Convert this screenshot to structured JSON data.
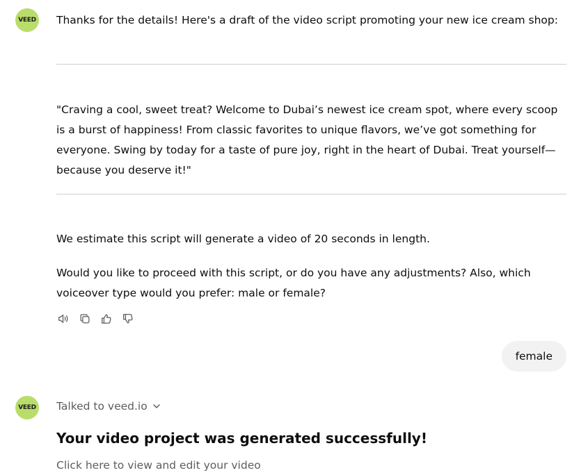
{
  "assistant": {
    "avatar_label": "VEED",
    "intro": "Thanks for the details! Here's a draft of the video script promoting your new ice cream shop:",
    "script_quote": "\"Craving a cool, sweet treat? Welcome to Dubai’s newest ice cream spot, where every scoop is a burst of happiness! From classic favorites to unique flavors, we’ve got something for everyone. Swing by today for a taste of pure joy, right in the heart of Dubai. Treat yourself—because you deserve it!\"",
    "estimate": "We estimate this script will generate a video of 20 seconds in length.",
    "question": "Would you like to proceed with this script, or do you have any adjustments? Also, which voiceover type would you prefer: male or female?",
    "actions": [
      "read-aloud-icon",
      "copy-icon",
      "thumbs-up-icon",
      "thumbs-down-icon"
    ]
  },
  "user": {
    "message": "female"
  },
  "assistant2": {
    "avatar_label": "VEED",
    "tool_label": "Talked to veed.io",
    "success_title": "Your video project was generated successfully!",
    "view_link": "Click here to view and edit your video"
  },
  "colors": {
    "avatar_bg": "#b9dd6b",
    "user_bubble_bg": "#f2f2f2",
    "divider": "#cfcfcf",
    "muted_text": "#5d5d5d"
  }
}
